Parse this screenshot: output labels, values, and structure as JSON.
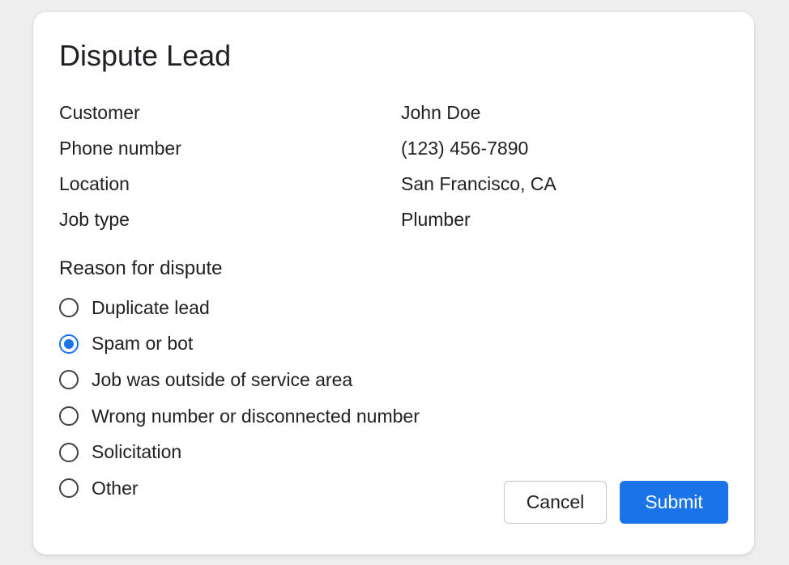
{
  "dialog": {
    "title": "Dispute Lead",
    "details": [
      {
        "label": "Customer",
        "value": "John Doe"
      },
      {
        "label": "Phone number",
        "value": "(123) 456-7890"
      },
      {
        "label": "Location",
        "value": "San Francisco, CA"
      },
      {
        "label": "Job type",
        "value": "Plumber"
      }
    ],
    "reason": {
      "title": "Reason for dispute",
      "selected_index": 1,
      "options": [
        {
          "label": "Duplicate lead",
          "selected": false
        },
        {
          "label": "Spam or bot",
          "selected": true
        },
        {
          "label": "Job was outside of service area",
          "selected": false
        },
        {
          "label": "Wrong number or disconnected number",
          "selected": false
        },
        {
          "label": "Solicitation",
          "selected": false
        },
        {
          "label": "Other",
          "selected": false
        }
      ]
    },
    "buttons": {
      "cancel_label": "Cancel",
      "submit_label": "Submit"
    }
  },
  "colors": {
    "accent": "#1a73e8",
    "background": "#eeeeee",
    "card": "#ffffff",
    "text": "#202124"
  }
}
